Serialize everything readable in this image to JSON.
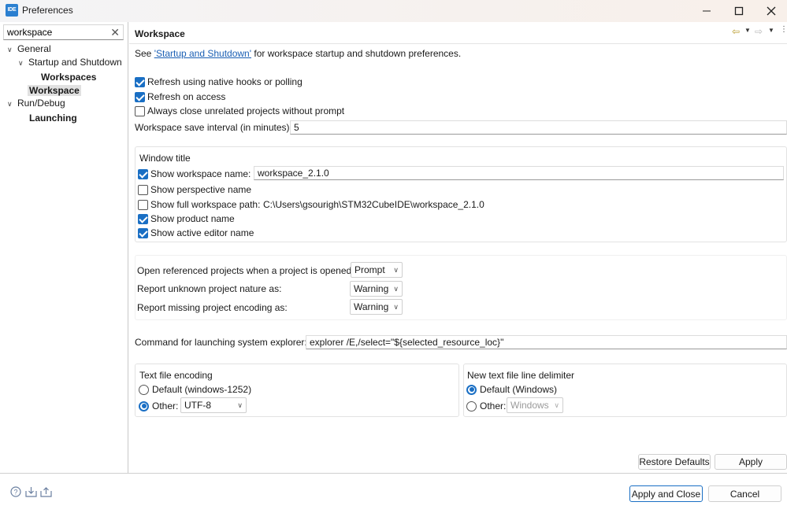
{
  "window": {
    "app_icon_text": "IDE",
    "title": "Preferences",
    "minimize_glyph": "—",
    "maximize_glyph": "☐",
    "close_glyph": "✕"
  },
  "filter": {
    "value": "workspace",
    "clear_glyph": "✕"
  },
  "tree": {
    "general": "General",
    "startup_shutdown": "Startup and Shutdown",
    "workspaces": "Workspaces",
    "workspace": "Workspace",
    "run_debug": "Run/Debug",
    "launching": "Launching"
  },
  "page": {
    "title": "Workspace",
    "see_prefix": "See ",
    "see_link": "'Startup and Shutdown'",
    "see_suffix": " for workspace startup and shutdown preferences."
  },
  "options": {
    "refresh_native": {
      "label": "Refresh using native hooks or polling",
      "checked": true
    },
    "refresh_access": {
      "label": "Refresh on access",
      "checked": true
    },
    "close_unrelated": {
      "label": "Always close unrelated projects without prompt",
      "checked": false
    },
    "save_interval_label": "Workspace save interval (in minutes):",
    "save_interval_value": "5"
  },
  "window_title_group": {
    "heading": "Window title",
    "show_workspace_name": {
      "label": "Show workspace name:",
      "checked": true,
      "value": "workspace_2.1.0"
    },
    "show_perspective_name": {
      "label": "Show perspective name",
      "checked": false
    },
    "show_full_path": {
      "label": "Show full workspace path:",
      "checked": false,
      "value": "C:\\Users\\gsourigh\\STM32CubeIDE\\workspace_2.1.0"
    },
    "show_product_name": {
      "label": "Show product name",
      "checked": true
    },
    "show_active_editor": {
      "label": "Show active editor name",
      "checked": true
    }
  },
  "projects": {
    "open_referenced_label": "Open referenced projects when a project is opened:",
    "open_referenced_value": "Prompt",
    "unknown_nature_label": "Report unknown project nature as:",
    "unknown_nature_value": "Warning",
    "missing_encoding_label": "Report missing project encoding as:",
    "missing_encoding_value": "Warning"
  },
  "explorer": {
    "label": "Command for launching system explorer:",
    "value": "explorer /E,/select=\"${selected_resource_loc}\""
  },
  "encoding": {
    "heading": "Text file encoding",
    "default_label": "Default (windows-1252)",
    "other_label": "Other:",
    "other_value": "UTF-8",
    "selected": "other"
  },
  "line_delimiter": {
    "heading": "New text file line delimiter",
    "default_label": "Default (Windows)",
    "other_label": "Other:",
    "other_value": "Windows",
    "selected": "default"
  },
  "buttons": {
    "restore_defaults": "Restore Defaults",
    "apply": "Apply",
    "apply_and_close": "Apply and Close",
    "cancel": "Cancel"
  },
  "icons": {
    "help": "help-icon",
    "import": "import-icon",
    "export": "export-icon",
    "back": "back-arrow-icon",
    "forward": "forward-arrow-icon",
    "menu": "view-menu-icon"
  },
  "colors": {
    "accent": "#1a6fc4",
    "link": "#1a5fb4"
  }
}
